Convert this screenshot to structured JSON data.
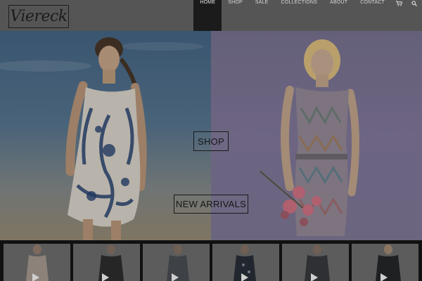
{
  "brand": {
    "logo_text": "Viereck"
  },
  "nav": {
    "items": [
      {
        "label": "HOME",
        "active": true
      },
      {
        "label": "SHOP",
        "active": false
      },
      {
        "label": "SALE",
        "active": false
      },
      {
        "label": "COLLECTIONS",
        "active": false
      },
      {
        "label": "ABOUT",
        "active": false
      },
      {
        "label": "CONTACT",
        "active": false
      }
    ],
    "icons": [
      "cart-icon",
      "search-icon"
    ]
  },
  "hero": {
    "shop_label": "SHOP",
    "new_arrivals_label": "NEW ARRIVALS"
  },
  "thumbnails": {
    "count": 6,
    "icon": "play-icon"
  },
  "colors": {
    "header_bg": "#555555",
    "nav_active_bg": "#1b1b1b",
    "strip_bg": "#111111"
  }
}
